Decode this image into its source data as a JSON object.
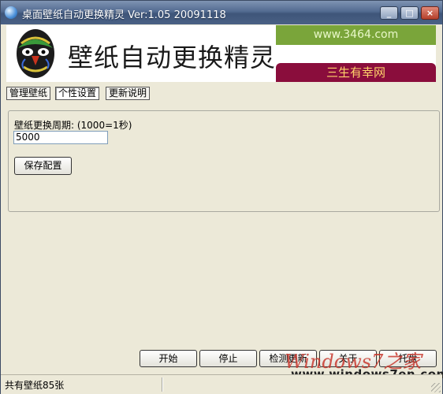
{
  "window": {
    "title": "桌面壁纸自动更换精灵 Ver:1.05 20091118",
    "controls": {
      "minimize": "_",
      "maximize": "□",
      "close": "×"
    }
  },
  "banner": {
    "title": "壁纸自动更换精灵",
    "ad_top": "www.3464.com",
    "ad_bottom": "三生有幸网"
  },
  "tabs": [
    {
      "label": "管理壁纸",
      "active": false
    },
    {
      "label": "个性设置",
      "active": true
    },
    {
      "label": "更新说明",
      "active": false
    }
  ],
  "settings": {
    "period_label": "壁纸更换周期: (1000=1秒)",
    "period_value": "5000",
    "save_label": "保存配置"
  },
  "bottom_buttons": {
    "start": "开始",
    "stop": "停止",
    "check_update": "检测更新",
    "about": "关于",
    "tray": "托盘"
  },
  "status": {
    "text": "共有壁纸85张"
  },
  "watermark": {
    "logo": "Windows7之家",
    "url": "www.windows7en.com"
  },
  "colors": {
    "titlebar": "#536b91",
    "ad_top_bg": "#7aa53a",
    "ad_bottom_bg": "#8a0d3c",
    "ad_bottom_text": "#ffd36b"
  }
}
